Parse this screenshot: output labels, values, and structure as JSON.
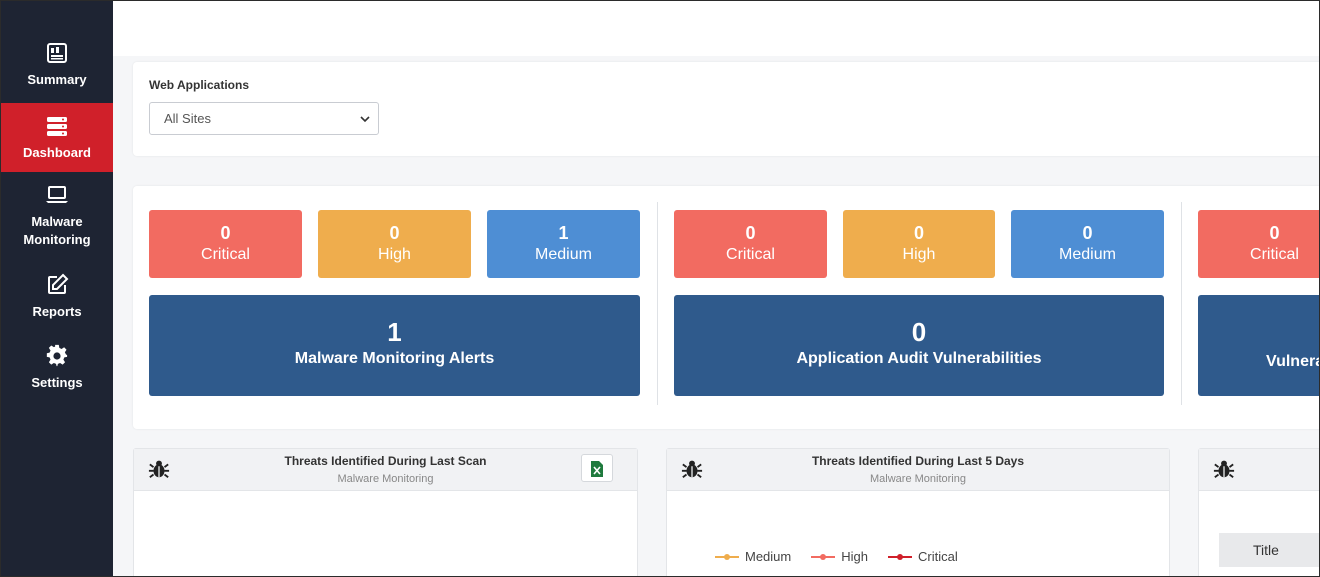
{
  "sidebar": {
    "items": [
      {
        "label": "Summary",
        "icon": "summary-icon"
      },
      {
        "label": "Dashboard",
        "icon": "dashboard-icon",
        "active": true
      },
      {
        "label": "Malware Monitoring",
        "icon": "laptop-icon"
      },
      {
        "label": "Reports",
        "icon": "edit-icon"
      },
      {
        "label": "Settings",
        "icon": "gear-icon"
      }
    ]
  },
  "filter": {
    "label": "Web Applications",
    "selected": "All Sites"
  },
  "groups": [
    {
      "critical": {
        "value": "0",
        "label": "Critical"
      },
      "high": {
        "value": "0",
        "label": "High"
      },
      "medium": {
        "value": "1",
        "label": "Medium"
      },
      "total": {
        "value": "1",
        "label": "Malware Monitoring Alerts"
      }
    },
    {
      "critical": {
        "value": "0",
        "label": "Critical"
      },
      "high": {
        "value": "0",
        "label": "High"
      },
      "medium": {
        "value": "0",
        "label": "Medium"
      },
      "total": {
        "value": "0",
        "label": "Application Audit Vulnerabilities"
      }
    },
    {
      "critical": {
        "value": "0",
        "label": "Critical"
      },
      "total": {
        "label": "Vulnera"
      }
    }
  ],
  "panels": [
    {
      "title": "Threats Identified During Last Scan",
      "subtitle": "Malware Monitoring",
      "icon": "bug-icon"
    },
    {
      "title": "Threats Identified During Last 5 Days",
      "subtitle": "Malware Monitoring",
      "icon": "bug-icon",
      "legend": [
        {
          "label": "Medium",
          "color": "#efad4d"
        },
        {
          "label": "High",
          "color": "#f26b61"
        },
        {
          "label": "Critical",
          "color": "#d0202a"
        }
      ]
    },
    {
      "icon": "bug-icon",
      "table_header": "Title"
    }
  ],
  "colors": {
    "sidebar_bg": "#1e2433",
    "active": "#d0202a",
    "critical": "#f26b61",
    "high": "#efad4d",
    "medium": "#4e8ed4",
    "total": "#2f5a8c"
  }
}
